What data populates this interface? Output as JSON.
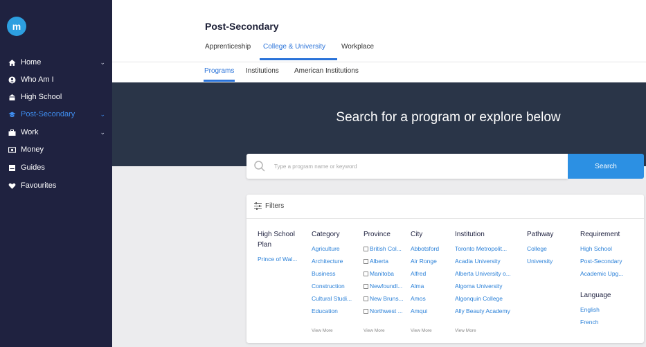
{
  "sidebar": {
    "logo": "m",
    "items": [
      {
        "label": "Home",
        "icon": "home-icon",
        "chevron": "⌄"
      },
      {
        "label": "Who Am I",
        "icon": "person-icon",
        "chevron": ""
      },
      {
        "label": "High School",
        "icon": "school-icon",
        "chevron": ""
      },
      {
        "label": "Post-Secondary",
        "icon": "graduation-cap-icon",
        "chevron": "⌄"
      },
      {
        "label": "Work",
        "icon": "briefcase-icon",
        "chevron": "⌄"
      },
      {
        "label": "Money",
        "icon": "money-icon",
        "chevron": ""
      },
      {
        "label": "Guides",
        "icon": "book-icon",
        "chevron": ""
      },
      {
        "label": "Favourites",
        "icon": "heart-icon",
        "chevron": ""
      }
    ],
    "active_index": 3
  },
  "header": {
    "title": "Post-Secondary",
    "tabs": [
      "Apprenticeship",
      "College & University",
      "Workplace"
    ],
    "selected_tab": 1
  },
  "subnav": {
    "tabs": [
      "Programs",
      "Institutions",
      "American Institutions"
    ],
    "selected_tab": 0
  },
  "hero": {
    "text": "Search for a program or explore below"
  },
  "search": {
    "placeholder": "Type a program name or keyword",
    "button_label": "Search"
  },
  "filters": {
    "label": "Filters",
    "high_school_plan": {
      "title": "High School Plan",
      "options": [
        "Prince of Wal..."
      ]
    },
    "category": {
      "title": "Category",
      "options": [
        "Agriculture",
        "Architecture",
        "Business",
        "Construction",
        "Cultural Studi...",
        "Education"
      ],
      "more": "View More"
    },
    "province": {
      "title": "Province",
      "options": [
        "British Col...",
        "Alberta",
        "Manitoba",
        "Newfoundl...",
        "New Bruns...",
        "Northwest ..."
      ],
      "more": "View More"
    },
    "city": {
      "title": "City",
      "options": [
        "Abbotsford",
        "Air Ronge",
        "Alfred",
        "Alma",
        "Amos",
        "Amqui"
      ],
      "more": "View More"
    },
    "institution": {
      "title": "Institution",
      "options": [
        "Toronto Metropolit...",
        "Acadia University",
        "Alberta University o...",
        "Algoma University",
        "Algonquin College",
        "Ally Beauty Academy"
      ],
      "more": "View More"
    },
    "pathway": {
      "title": "Pathway",
      "options": [
        "College",
        "University"
      ]
    },
    "requirement": {
      "title": "Requirement",
      "options": [
        "High School",
        "Post-Secondary",
        "Academic Upg..."
      ]
    },
    "language": {
      "title": "Language",
      "options": [
        "English",
        "French"
      ]
    }
  },
  "colors": {
    "sidebar": "#1f2240",
    "accent": "#2a73d9",
    "hero": "#2a3548",
    "search_button": "#2c90e3"
  }
}
